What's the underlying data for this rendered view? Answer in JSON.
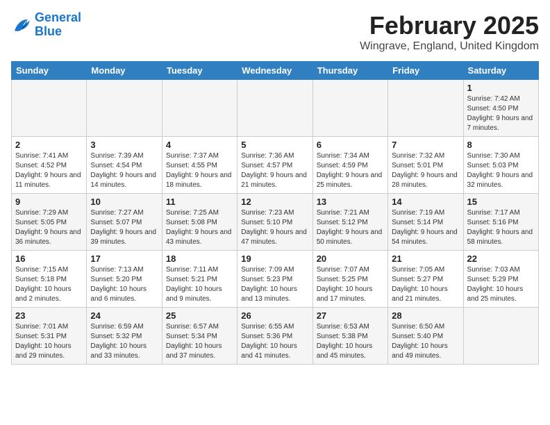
{
  "header": {
    "logo_line1": "General",
    "logo_line2": "Blue",
    "title": "February 2025",
    "subtitle": "Wingrave, England, United Kingdom"
  },
  "days_of_week": [
    "Sunday",
    "Monday",
    "Tuesday",
    "Wednesday",
    "Thursday",
    "Friday",
    "Saturday"
  ],
  "weeks": [
    [
      {
        "day": "",
        "info": ""
      },
      {
        "day": "",
        "info": ""
      },
      {
        "day": "",
        "info": ""
      },
      {
        "day": "",
        "info": ""
      },
      {
        "day": "",
        "info": ""
      },
      {
        "day": "",
        "info": ""
      },
      {
        "day": "1",
        "info": "Sunrise: 7:42 AM\nSunset: 4:50 PM\nDaylight: 9 hours and 7 minutes."
      }
    ],
    [
      {
        "day": "2",
        "info": "Sunrise: 7:41 AM\nSunset: 4:52 PM\nDaylight: 9 hours and 11 minutes."
      },
      {
        "day": "3",
        "info": "Sunrise: 7:39 AM\nSunset: 4:54 PM\nDaylight: 9 hours and 14 minutes."
      },
      {
        "day": "4",
        "info": "Sunrise: 7:37 AM\nSunset: 4:55 PM\nDaylight: 9 hours and 18 minutes."
      },
      {
        "day": "5",
        "info": "Sunrise: 7:36 AM\nSunset: 4:57 PM\nDaylight: 9 hours and 21 minutes."
      },
      {
        "day": "6",
        "info": "Sunrise: 7:34 AM\nSunset: 4:59 PM\nDaylight: 9 hours and 25 minutes."
      },
      {
        "day": "7",
        "info": "Sunrise: 7:32 AM\nSunset: 5:01 PM\nDaylight: 9 hours and 28 minutes."
      },
      {
        "day": "8",
        "info": "Sunrise: 7:30 AM\nSunset: 5:03 PM\nDaylight: 9 hours and 32 minutes."
      }
    ],
    [
      {
        "day": "9",
        "info": "Sunrise: 7:29 AM\nSunset: 5:05 PM\nDaylight: 9 hours and 36 minutes."
      },
      {
        "day": "10",
        "info": "Sunrise: 7:27 AM\nSunset: 5:07 PM\nDaylight: 9 hours and 39 minutes."
      },
      {
        "day": "11",
        "info": "Sunrise: 7:25 AM\nSunset: 5:08 PM\nDaylight: 9 hours and 43 minutes."
      },
      {
        "day": "12",
        "info": "Sunrise: 7:23 AM\nSunset: 5:10 PM\nDaylight: 9 hours and 47 minutes."
      },
      {
        "day": "13",
        "info": "Sunrise: 7:21 AM\nSunset: 5:12 PM\nDaylight: 9 hours and 50 minutes."
      },
      {
        "day": "14",
        "info": "Sunrise: 7:19 AM\nSunset: 5:14 PM\nDaylight: 9 hours and 54 minutes."
      },
      {
        "day": "15",
        "info": "Sunrise: 7:17 AM\nSunset: 5:16 PM\nDaylight: 9 hours and 58 minutes."
      }
    ],
    [
      {
        "day": "16",
        "info": "Sunrise: 7:15 AM\nSunset: 5:18 PM\nDaylight: 10 hours and 2 minutes."
      },
      {
        "day": "17",
        "info": "Sunrise: 7:13 AM\nSunset: 5:20 PM\nDaylight: 10 hours and 6 minutes."
      },
      {
        "day": "18",
        "info": "Sunrise: 7:11 AM\nSunset: 5:21 PM\nDaylight: 10 hours and 9 minutes."
      },
      {
        "day": "19",
        "info": "Sunrise: 7:09 AM\nSunset: 5:23 PM\nDaylight: 10 hours and 13 minutes."
      },
      {
        "day": "20",
        "info": "Sunrise: 7:07 AM\nSunset: 5:25 PM\nDaylight: 10 hours and 17 minutes."
      },
      {
        "day": "21",
        "info": "Sunrise: 7:05 AM\nSunset: 5:27 PM\nDaylight: 10 hours and 21 minutes."
      },
      {
        "day": "22",
        "info": "Sunrise: 7:03 AM\nSunset: 5:29 PM\nDaylight: 10 hours and 25 minutes."
      }
    ],
    [
      {
        "day": "23",
        "info": "Sunrise: 7:01 AM\nSunset: 5:31 PM\nDaylight: 10 hours and 29 minutes."
      },
      {
        "day": "24",
        "info": "Sunrise: 6:59 AM\nSunset: 5:32 PM\nDaylight: 10 hours and 33 minutes."
      },
      {
        "day": "25",
        "info": "Sunrise: 6:57 AM\nSunset: 5:34 PM\nDaylight: 10 hours and 37 minutes."
      },
      {
        "day": "26",
        "info": "Sunrise: 6:55 AM\nSunset: 5:36 PM\nDaylight: 10 hours and 41 minutes."
      },
      {
        "day": "27",
        "info": "Sunrise: 6:53 AM\nSunset: 5:38 PM\nDaylight: 10 hours and 45 minutes."
      },
      {
        "day": "28",
        "info": "Sunrise: 6:50 AM\nSunset: 5:40 PM\nDaylight: 10 hours and 49 minutes."
      },
      {
        "day": "",
        "info": ""
      }
    ]
  ]
}
